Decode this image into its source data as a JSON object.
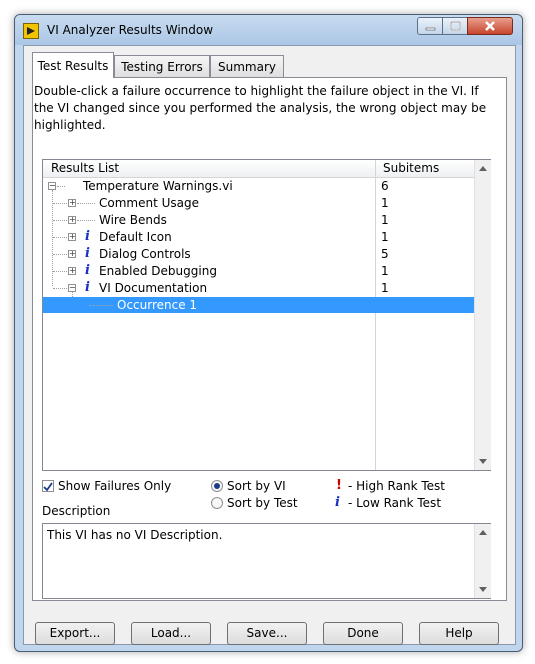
{
  "window": {
    "title": "VI Analyzer Results Window"
  },
  "tabs": [
    {
      "label": "Test Results",
      "active": true
    },
    {
      "label": "Testing Errors",
      "active": false
    },
    {
      "label": "Summary",
      "active": false
    }
  ],
  "instructions": "Double-click a failure occurrence to highlight the failure object in the VI.  If the VI changed since you performed the analysis, the wrong object may be highlighted.",
  "results_list": {
    "col_results": "Results List",
    "col_subitems": "Subitems",
    "rows": [
      {
        "label": "Temperature Warnings.vi",
        "count": "6",
        "level": 0,
        "icon": "none"
      },
      {
        "label": "Comment Usage",
        "count": "1",
        "level": 1,
        "icon": "none"
      },
      {
        "label": "Wire Bends",
        "count": "1",
        "level": 1,
        "icon": "none"
      },
      {
        "label": "Default Icon",
        "count": "1",
        "level": 1,
        "icon": "info-icon"
      },
      {
        "label": "Dialog Controls",
        "count": "5",
        "level": 1,
        "icon": "info-icon"
      },
      {
        "label": "Enabled Debugging",
        "count": "1",
        "level": 1,
        "icon": "info-icon"
      },
      {
        "label": "VI Documentation",
        "count": "1",
        "level": 1,
        "icon": "info-icon"
      },
      {
        "label": "Occurrence 1",
        "count": "",
        "level": 2,
        "icon": "none"
      }
    ]
  },
  "options": {
    "show_failures_only": "Show Failures Only",
    "show_failures_only_checked": true,
    "sort_by_vi": "Sort by VI",
    "sort_by_test": "Sort by Test",
    "sort_selected": "Sort by VI",
    "high_rank_symbol": "!",
    "high_rank": " - High Rank Test",
    "low_rank_symbol": "i",
    "low_rank": " - Low Rank Test"
  },
  "description": {
    "label": "Description",
    "text": "This VI has no VI Description."
  },
  "buttons": {
    "export": "Export...",
    "load": "Load...",
    "save": "Save...",
    "done": "Done",
    "help": "Help"
  },
  "colors": {
    "selection": "#3399ff",
    "info_icon": "#1a2ec0",
    "high_rank": "#cc0000"
  }
}
